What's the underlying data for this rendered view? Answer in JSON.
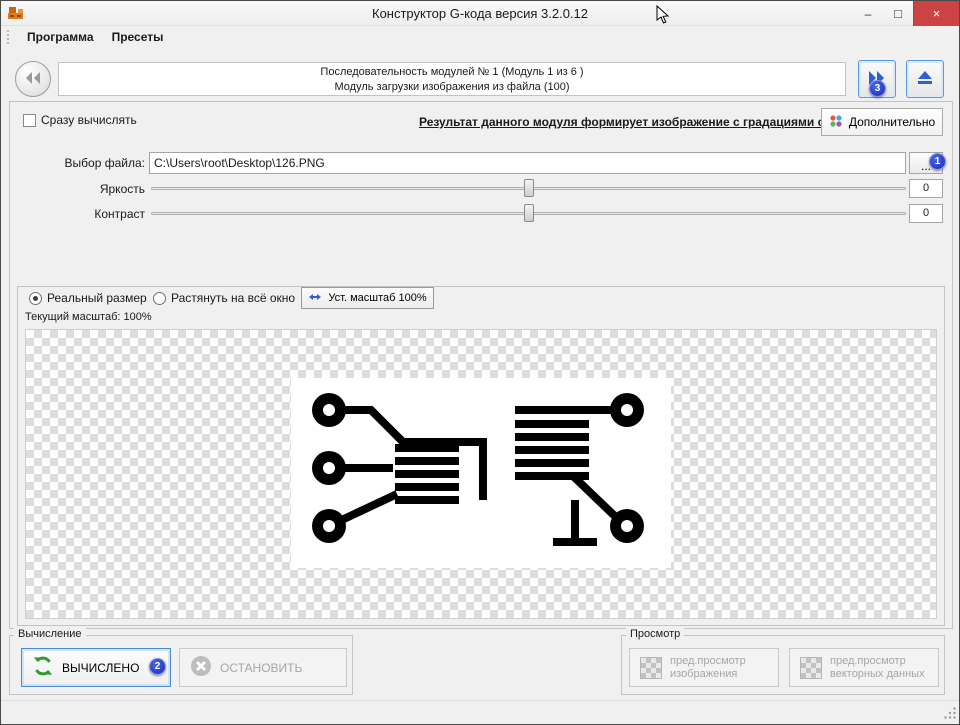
{
  "window": {
    "title": "Конструктор G-кода версия 3.2.0.12",
    "minimize_label": "–",
    "maximize_label": "□",
    "close_label": "×"
  },
  "menu": {
    "items": [
      {
        "label": "Программа"
      },
      {
        "label": "Пресеты"
      }
    ]
  },
  "nav": {
    "sequence_line": "Последовательность модулей № 1 (Модуль 1 из 6 )",
    "module_line": "Модуль загрузки изображения из файла (100)"
  },
  "module": {
    "auto_compute_label": "Сразу вычислять",
    "result_note": "Результат данного модуля формирует изображение с градациями серого",
    "advanced_label": "Дополнительно",
    "file_label": "Выбор файла:",
    "file_path": "C:\\Users\\root\\Desktop\\126.PNG",
    "browse_label": "...",
    "brightness_label": "Яркость",
    "brightness_value": "0",
    "contrast_label": "Контраст",
    "contrast_value": "0"
  },
  "preview": {
    "real_size_label": "Реальный размер",
    "stretch_label": "Растянуть на всё окно",
    "set_scale_label": "Уст. масштаб 100%",
    "current_scale_label": "Текущий масштаб: 100%"
  },
  "compute": {
    "group_label": "Вычисление",
    "computed_label": "ВЫЧИСЛЕНО",
    "stop_label": "ОСТАНОВИТЬ"
  },
  "view": {
    "group_label": "Просмотр",
    "image_preview_line1": "пред.просмотр",
    "image_preview_line2": "изображения",
    "vector_preview_line1": "пред.просмотр",
    "vector_preview_line2": "векторных данных"
  },
  "annotations": {
    "badge1": "1",
    "badge2": "2",
    "badge3": "3"
  },
  "icons": {
    "prev_module": "double-left-arrows",
    "next_module": "double-right-arrows",
    "run_all": "eject",
    "advanced": "colored-dots",
    "computed": "green-recycle-arrows",
    "stop": "gray-circle-x"
  }
}
